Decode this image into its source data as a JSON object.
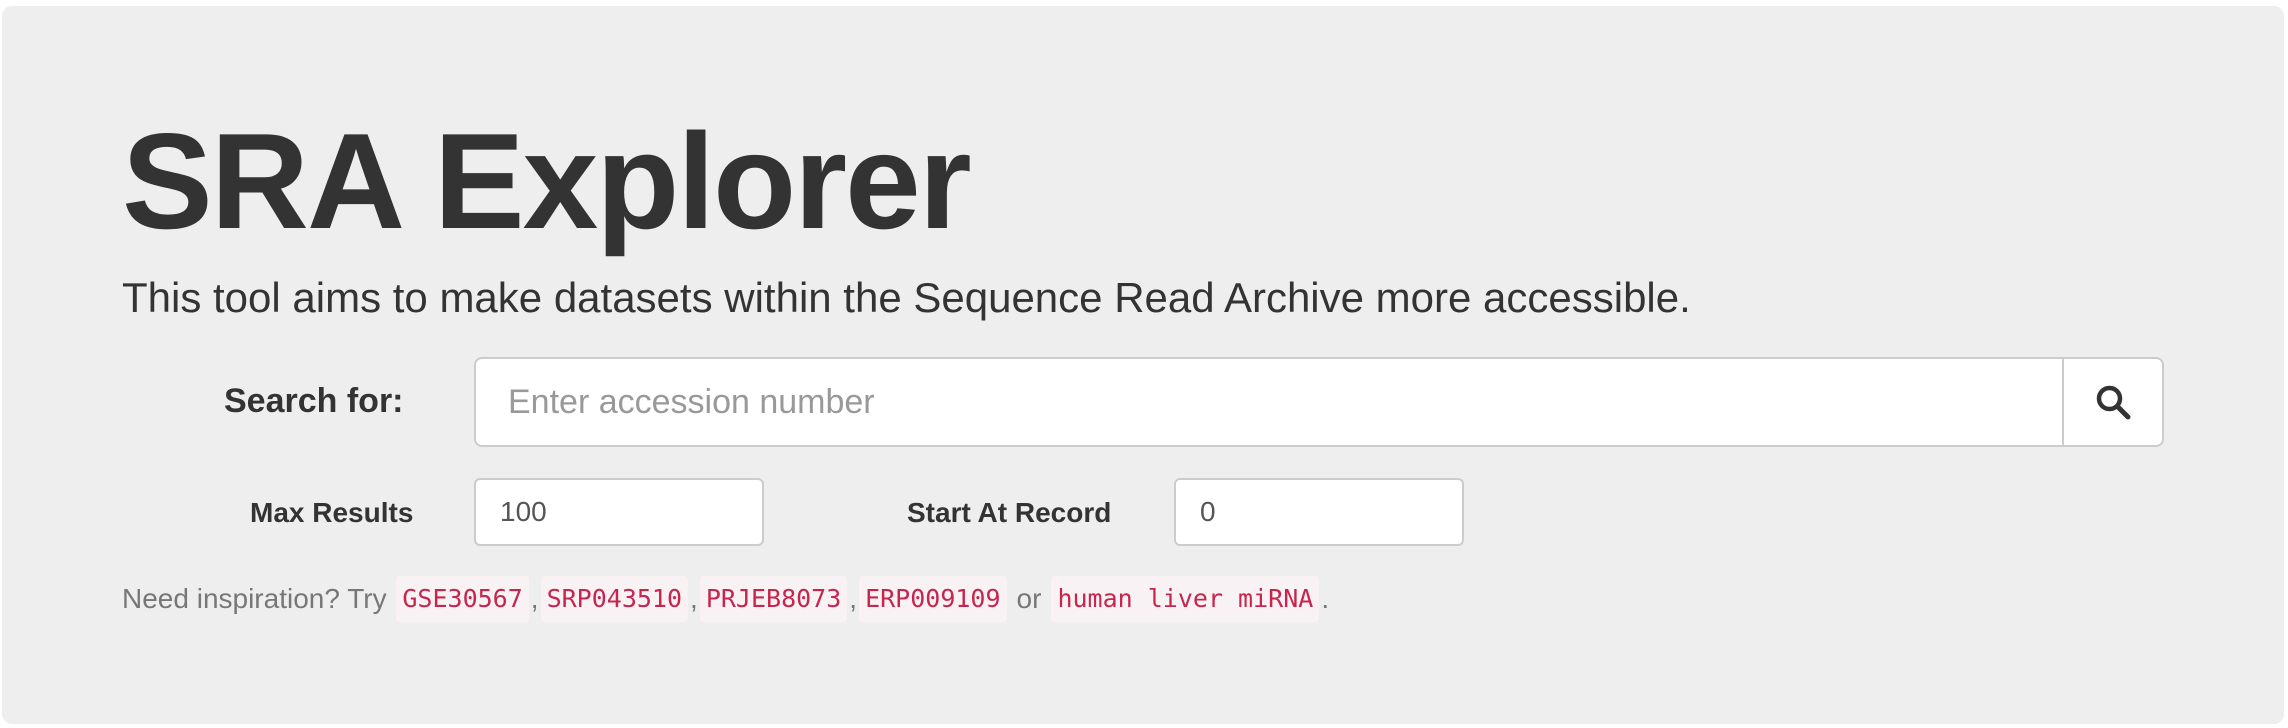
{
  "header": {
    "title": "SRA Explorer",
    "lead": "This tool aims to make datasets within the Sequence Read Archive more accessible."
  },
  "search": {
    "label": "Search for:",
    "placeholder": "Enter accession number",
    "value": "",
    "button_icon": "search-icon"
  },
  "options": {
    "max_results_label": "Max Results",
    "max_results_value": "100",
    "start_at_label": "Start At Record",
    "start_at_value": "0"
  },
  "inspiration": {
    "prefix": "Need inspiration? Try ",
    "examples": [
      "GSE30567",
      "SRP043510",
      "PRJEB8073",
      "ERP009109",
      "human liver miRNA"
    ],
    "comma": ",",
    "or": "or",
    "period": "."
  },
  "colors": {
    "background": "#eeeeee",
    "code_text": "#c7254e",
    "code_background": "#f9f2f4"
  }
}
